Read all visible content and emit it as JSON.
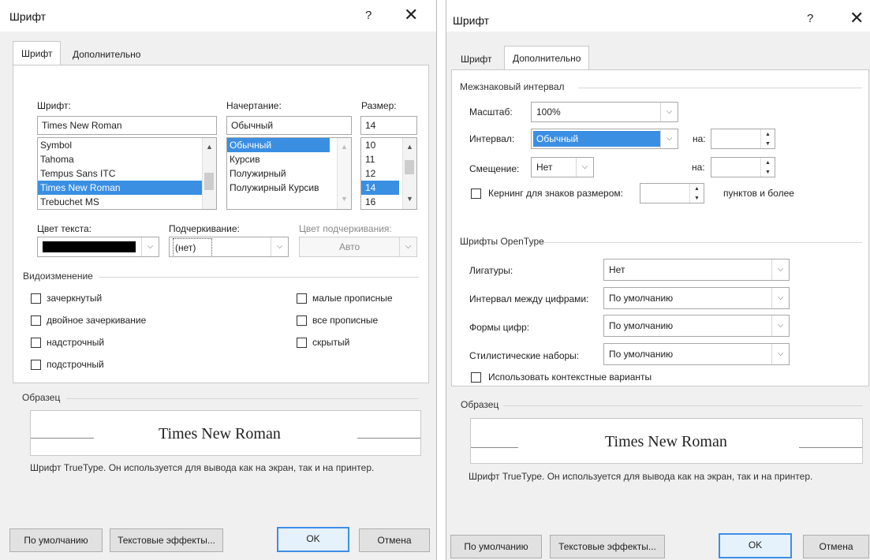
{
  "left": {
    "title": "Шрифт",
    "help_glyph": "?",
    "close_glyph": "✕",
    "tabs": [
      {
        "label": "Шрифт"
      },
      {
        "label": "Дополнительно"
      }
    ],
    "font_label": "Шрифт:",
    "style_label": "Начертание:",
    "size_label": "Размер:",
    "font_value": "Times New Roman",
    "style_value": "Обычный",
    "size_value": "14",
    "font_list": [
      "Symbol",
      "Tahoma",
      "Tempus Sans ITC",
      "Times New Roman",
      "Trebuchet MS"
    ],
    "style_list": [
      "Обычный",
      "Курсив",
      "Полужирный",
      "Полужирный Курсив"
    ],
    "size_list": [
      "10",
      "11",
      "12",
      "14",
      "16"
    ],
    "text_color_label": "Цвет текста:",
    "underline_label": "Подчеркивание:",
    "underline_value": "(нет)",
    "underline_color_label": "Цвет подчеркивания:",
    "underline_color_value": "Авто",
    "effects_label": "Видоизменение",
    "effects_left": [
      "зачеркнутый",
      "двойное зачеркивание",
      "надстрочный",
      "подстрочный"
    ],
    "effects_right": [
      "малые прописные",
      "все прописные",
      "скрытый"
    ],
    "sample_label": "Образец",
    "sample_text": "Times New Roman",
    "description": "Шрифт TrueType. Он используется для вывода как на экран, так и на принтер.",
    "buttons": {
      "default": "По умолчанию",
      "effects": "Текстовые эффекты...",
      "ok": "OK",
      "cancel": "Отмена"
    },
    "colors": {
      "selection": "#3a8fe3",
      "text_color": "#000000"
    }
  },
  "right": {
    "title": "Шрифт",
    "help_glyph": "?",
    "close_glyph": "✕",
    "tabs": [
      {
        "label": "Шрифт"
      },
      {
        "label": "Дополнительно"
      }
    ],
    "spacing_group": "Межзнаковый интервал",
    "scale_label": "Масштаб:",
    "scale_value": "100%",
    "spacing_label": "Интервал:",
    "spacing_value": "Обычный",
    "by_label": "на:",
    "position_label": "Смещение:",
    "position_value": "Нет",
    "by_label2": "на:",
    "kerning_label": "Кернинг для знаков размером:",
    "kerning_suffix": "пунктов и более",
    "opentype_group": "Шрифты OpenType",
    "ligatures_label": "Лигатуры:",
    "ligatures_value": "Нет",
    "num_spacing_label": "Интервал между цифрами:",
    "num_spacing_value": "По умолчанию",
    "num_forms_label": "Формы цифр:",
    "num_forms_value": "По умолчанию",
    "stylistic_label": "Стилистические наборы:",
    "stylistic_value": "По умолчанию",
    "contextual_label": "Использовать контекстные варианты",
    "sample_label": "Образец",
    "sample_text": "Times New Roman",
    "description": "Шрифт TrueType. Он используется для вывода как на экран, так и на принтер.",
    "buttons": {
      "default": "По умолчанию",
      "effects": "Текстовые эффекты...",
      "ok": "OK",
      "cancel": "Отмена"
    },
    "colors": {
      "selection": "#3a8fe3"
    }
  }
}
